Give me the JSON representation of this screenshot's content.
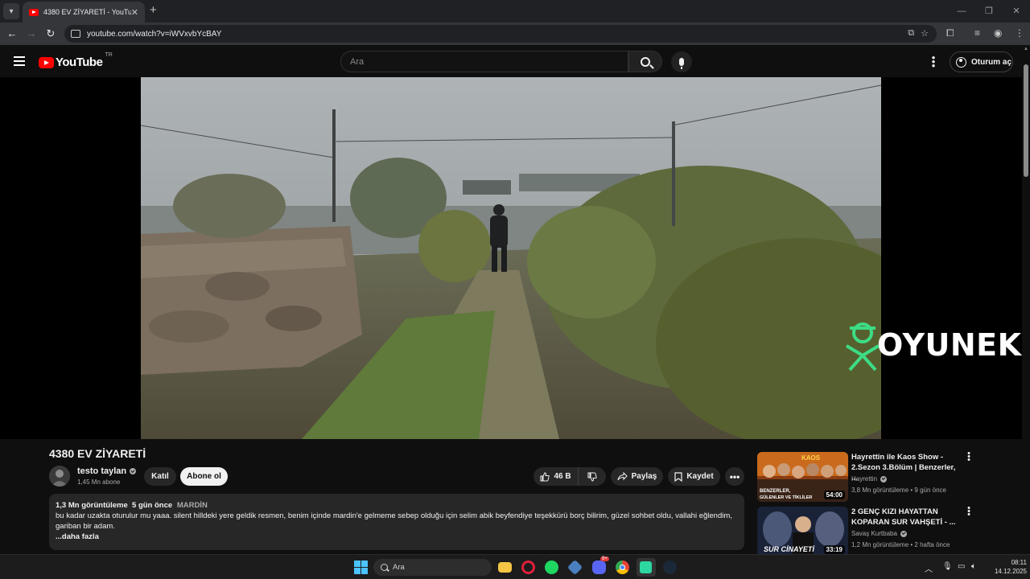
{
  "browser": {
    "tab_title": "4380 EV ZİYARETİ - YouTube",
    "tab_close": "✕",
    "new_tab": "+",
    "url": "youtube.com/watch?v=iWVxvbYcBAY",
    "window_controls": [
      "—",
      "❐",
      "✕"
    ]
  },
  "header": {
    "logo_word": "YouTube",
    "country_code": "TR",
    "search_placeholder": "Ara",
    "signin_label": "Oturum aç"
  },
  "video": {
    "watermark": "OYUNEKS",
    "title": "4380 EV ZİYARETİ"
  },
  "channel": {
    "name": "testo taylan",
    "subscribers": "1,45 Mn abone",
    "join_label": "Katıl",
    "subscribe_label": "Abone ol"
  },
  "actions": {
    "like_count": "46 B",
    "share_label": "Paylaş",
    "save_label": "Kaydet"
  },
  "description": {
    "views": "1,3 Mn görüntüleme",
    "age": "5 gün önce",
    "hashtag": "MARDİN",
    "text": "bu kadar uzakta oturulur mu yaaa. silent hilldeki yere geldik resmen, benim içinde mardin'e gelmeme sebep olduğu için selim abik beyfendiye teşekkürü borç bilirim, güzel sohbet oldu, vallahi eğlendim, gariban bir adam.",
    "more": "...daha fazla"
  },
  "recommendations": [
    {
      "title": "Hayrettin ile Kaos Show - 2.Sezon 3.Bölüm | Benzerler, ...",
      "channel": "Hayrettin",
      "meta": "3,8 Mn görüntüleme • 9 gün önce",
      "duration": "54:00",
      "thumb_caption": "BENZERLER, GÜLENLER VE TİKLİLER",
      "thumb_badge": "KAOS"
    },
    {
      "title": "2 GENÇ KIZI HAYATTAN KOPARAN SUR VAHŞETİ - ...",
      "channel": "Savaş Kurtbaba",
      "meta": "1,2 Mn görüntüleme • 2 hafta önce",
      "duration": "33:19",
      "thumb_caption": "SUR CİNAYETİ"
    }
  ],
  "taskbar": {
    "search_label": "Ara",
    "time": "08:11",
    "date": "14.12.2025",
    "discord_badge": "9+"
  },
  "colors": {
    "youtube_red": "#ff0000",
    "background": "#0f0f0f",
    "button_bg": "#272727",
    "watermark_green": "#3ddc84"
  }
}
